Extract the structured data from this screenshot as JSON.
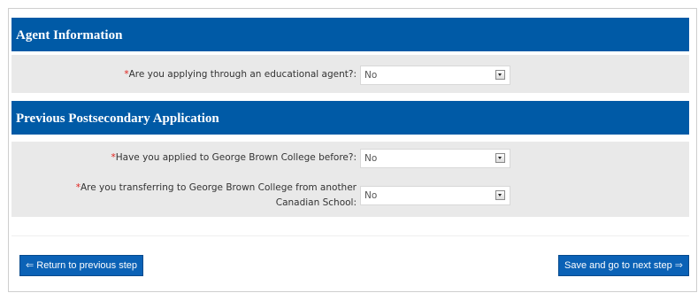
{
  "agent_section": {
    "title": "Agent Information",
    "fields": [
      {
        "required_marker": "*",
        "label": "Are you applying through an educational agent?:",
        "selected_value": "No"
      }
    ]
  },
  "previous_section": {
    "title": "Previous Postsecondary Application",
    "fields": [
      {
        "required_marker": "*",
        "label": "Have you applied to George Brown College before?:",
        "selected_value": "No"
      },
      {
        "required_marker": "*",
        "label_line1": "Are you transferring to George Brown College from another",
        "label_line2": "Canadian School:",
        "selected_value": "No"
      }
    ]
  },
  "navigation": {
    "back_label": "Return to previous step",
    "next_label": "Save and go to next step",
    "back_arrow": "⇐",
    "next_arrow": "⇒"
  },
  "colors": {
    "header_bg": "#005aa6",
    "panel_bg": "#e9e9e9",
    "required": "#e0201b",
    "button_bg": "#0b62b6"
  }
}
